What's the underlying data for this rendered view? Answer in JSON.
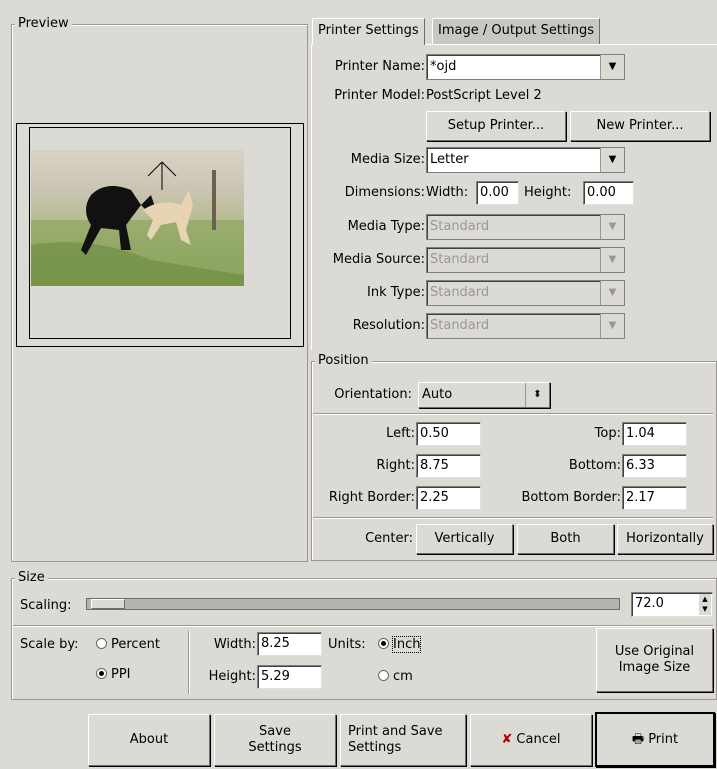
{
  "preview": {
    "title": "Preview"
  },
  "tabs": [
    {
      "label": "Printer Settings"
    },
    {
      "label": "Image / Output Settings"
    }
  ],
  "printer": {
    "name_label": "Printer Name:",
    "name_value": "*ojd",
    "model_label": "Printer Model:",
    "model_value": "PostScript Level 2",
    "setup_button": "Setup Printer...",
    "new_button": "New Printer...",
    "media_size_label": "Media Size:",
    "media_size_value": "Letter",
    "dimensions_label": "Dimensions:",
    "width_label": "Width:",
    "width_value": "0.00",
    "height_label": "Height:",
    "height_value": "0.00",
    "media_type_label": "Media Type:",
    "media_type_value": "Standard",
    "media_source_label": "Media Source:",
    "media_source_value": "Standard",
    "ink_type_label": "Ink Type:",
    "ink_type_value": "Standard",
    "resolution_label": "Resolution:",
    "resolution_value": "Standard"
  },
  "position": {
    "title": "Position",
    "orientation_label": "Orientation:",
    "orientation_value": "Auto",
    "left_label": "Left:",
    "left_value": "0.50",
    "top_label": "Top:",
    "top_value": "1.04",
    "right_label": "Right:",
    "right_value": "8.75",
    "bottom_label": "Bottom:",
    "bottom_value": "6.33",
    "right_border_label": "Right Border:",
    "right_border_value": "2.25",
    "bottom_border_label": "Bottom Border:",
    "bottom_border_value": "2.17",
    "center_label": "Center:",
    "vertically_button": "Vertically",
    "both_button": "Both",
    "horizontally_button": "Horizontally"
  },
  "size": {
    "title": "Size",
    "scaling_label": "Scaling:",
    "scaling_value": "72.0",
    "scale_by_label": "Scale by:",
    "percent_label": "Percent",
    "ppi_label": "PPI",
    "width_label": "Width:",
    "width_value": "8.25",
    "height_label": "Height:",
    "height_value": "5.29",
    "units_label": "Units:",
    "inch_label": "Inch",
    "cm_label": "cm",
    "use_original_button": "Use Original Image Size",
    "scale_by_selected": "PPI",
    "units_selected": "Inch"
  },
  "buttons": {
    "about": "About",
    "save_settings": "Save Settings",
    "print_and_save": "Print and Save Settings",
    "cancel": "Cancel",
    "print": "Print"
  }
}
